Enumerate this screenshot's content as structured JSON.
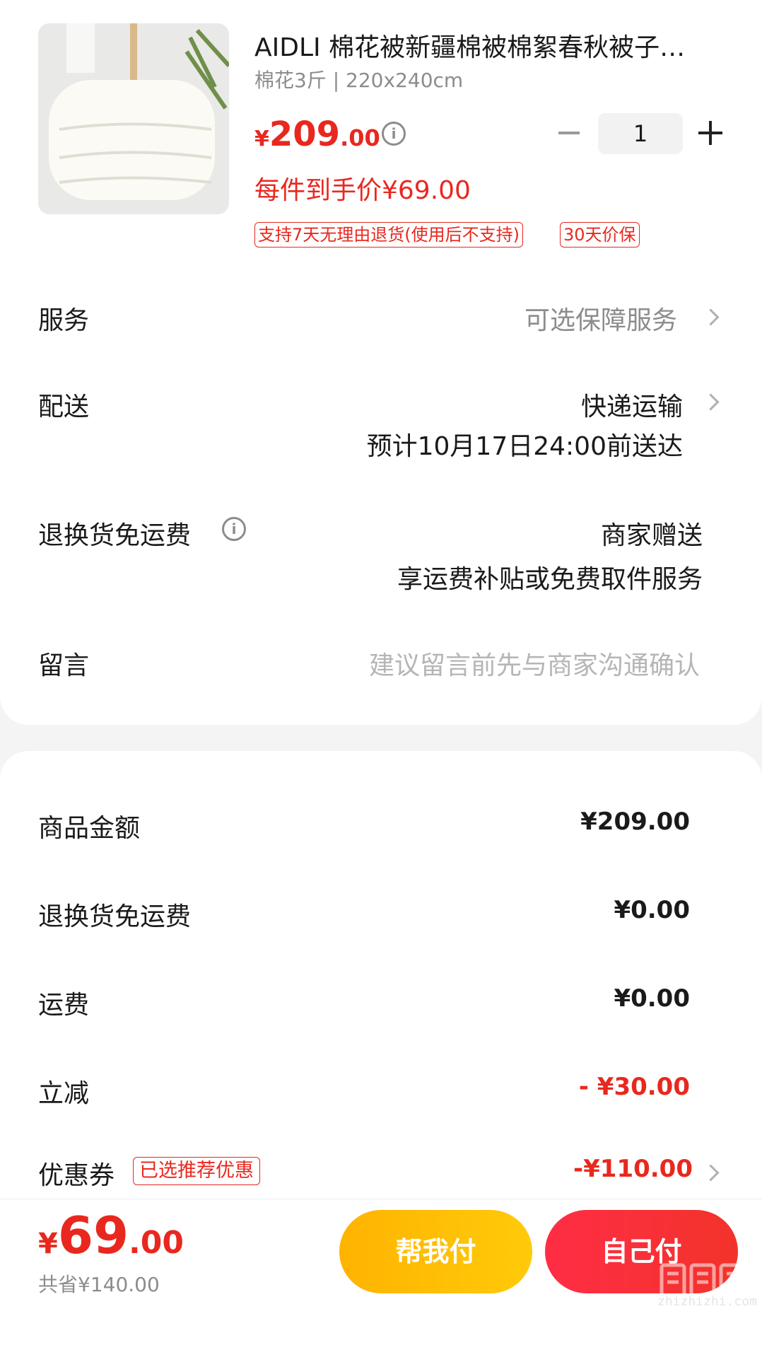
{
  "product": {
    "title": "AIDLI 棉花被新疆棉被棉絮春秋被子…",
    "spec": "棉花3斤 | 220x240cm",
    "price_symbol": "¥",
    "price_int": "209",
    "price_dec": ".00",
    "final_price": "每件到手价¥69.00",
    "quantity": "1",
    "tags": [
      "支持7天无理由退货(使用后不支持)",
      "30天价保"
    ]
  },
  "service": {
    "label": "服务",
    "value": "可选保障服务"
  },
  "delivery": {
    "label": "配送",
    "method": "快递运输",
    "eta": "预计10月17日24:00前送达"
  },
  "return_shipping": {
    "label": "退换货免运费",
    "value": "商家赠送",
    "desc": "享运费补贴或免费取件服务"
  },
  "message": {
    "label": "留言",
    "placeholder": "建议留言前先与商家沟通确认"
  },
  "summary": {
    "goods_label": "商品金额",
    "goods_value": "¥209.00",
    "return_label": "退换货免运费",
    "return_value": "¥0.00",
    "freight_label": "运费",
    "freight_value": "¥0.00",
    "discount_label": "立减",
    "discount_value": "- ¥30.00",
    "coupon_label": "优惠券",
    "coupon_badge": "已选推荐优惠",
    "coupon_value": "-¥110.00"
  },
  "footer": {
    "total_symbol": "¥",
    "total_int": "69",
    "total_dec": ".00",
    "saved": "共省¥140.00",
    "help_pay": "帮我付",
    "self_pay": "自己付"
  },
  "watermark": {
    "domain": "zhizhizhi.com"
  },
  "colors": {
    "accent": "#e8281f",
    "help_button": "#ffb300",
    "self_button": "#ff2d45"
  }
}
